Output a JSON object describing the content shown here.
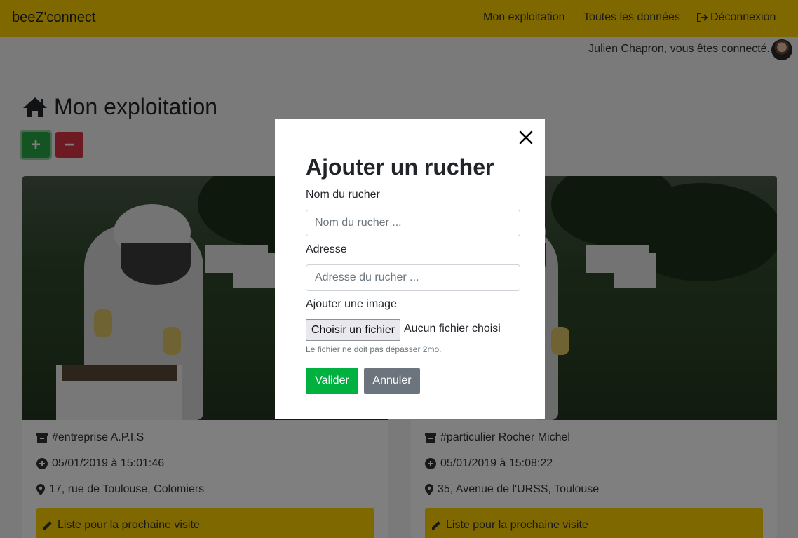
{
  "navbar": {
    "brand": "beeZ'connect",
    "links": [
      "Mon exploitation",
      "Toutes les données",
      "Déconnexion"
    ],
    "icons": {
      "logout": "sign-out-icon"
    }
  },
  "user": {
    "status": "Julien Chapron, vous êtes connecté."
  },
  "page": {
    "title": "Mon exploitation",
    "title_icon": "home-icon",
    "add_label": "+",
    "remove_label": "−"
  },
  "cards": [
    {
      "name": "#entreprise A.P.I.S",
      "date": "05/01/2019 à 15:01:46",
      "address": "17, rue de Toulouse, Colomiers",
      "visit_label": "Liste pour la prochaine visite"
    },
    {
      "name": "#particulier Rocher Michel",
      "date": "05/01/2019 à 15:08:22",
      "address": "35, Avenue de l'URSS, Toulouse",
      "visit_label": "Liste pour la prochaine visite"
    }
  ],
  "modal": {
    "title": "Ajouter un rucher",
    "name_label": "Nom du rucher",
    "name_placeholder": "Nom du rucher ...",
    "address_label": "Adresse",
    "address_placeholder": "Adresse du rucher ...",
    "image_label": "Ajouter une image",
    "file_button": "Choisir un fichier",
    "file_status": "Aucun fichier choisi",
    "help": "Le fichier ne doit pas dépasser 2mo.",
    "submit": "Valider",
    "cancel": "Annuler"
  },
  "colors": {
    "accent": "#ffd000",
    "success": "#28a745",
    "danger": "#dc3545",
    "secondary": "#6c757d"
  }
}
